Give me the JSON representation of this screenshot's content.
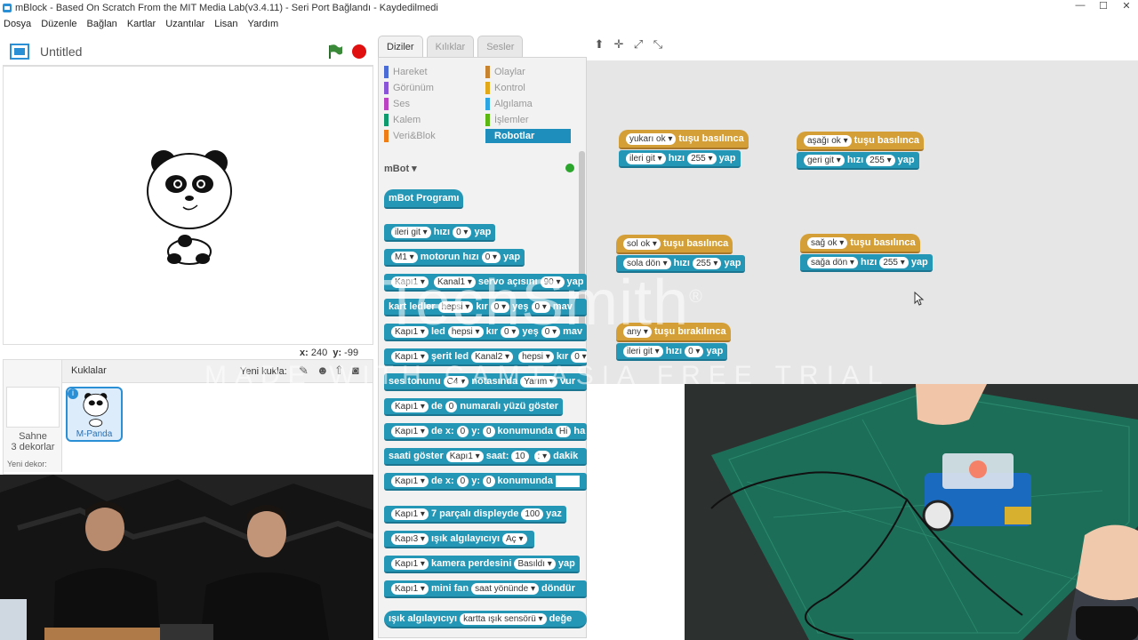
{
  "window": {
    "title": "mBlock - Based On Scratch From the MIT Media Lab(v3.4.11) - Seri Port Bağlandı - Kaydedilmedi"
  },
  "menu": [
    "Dosya",
    "Düzenle",
    "Bağlan",
    "Kartlar",
    "Uzantılar",
    "Lisan",
    "Yardım"
  ],
  "stage": {
    "title": "Untitled",
    "x_label": "x:",
    "x_value": "240",
    "y_label": "y:",
    "y_value": "-99"
  },
  "sprites": {
    "header": "Kuklalar",
    "new_sprite": "Yeni kukla:",
    "stage_label": "Sahne",
    "backdrops": "3 dekorlar",
    "new_backdrop": "Yeni dekor:",
    "sprite_name": "M-Panda"
  },
  "tabs": [
    "Diziler",
    "Kılıklar",
    "Sesler"
  ],
  "categories": [
    {
      "name": "Hareket",
      "color": "#4a6cd4"
    },
    {
      "name": "Görünüm",
      "color": "#8a55d7"
    },
    {
      "name": "Ses",
      "color": "#bb42c3"
    },
    {
      "name": "Kalem",
      "color": "#0e9a6c"
    },
    {
      "name": "Veri&Blok",
      "color": "#ee7d16"
    },
    {
      "name": "Olaylar",
      "color": "#c88330"
    },
    {
      "name": "Kontrol",
      "color": "#e1a91a"
    },
    {
      "name": "Algılama",
      "color": "#2ca5e2"
    },
    {
      "name": "İşlemler",
      "color": "#5cb712"
    },
    {
      "name": "Robotlar",
      "color": "#1e8ebc"
    }
  ],
  "palette": {
    "extension": "mBot",
    "hat": "mBot Programı",
    "b1": {
      "s": "ileri git",
      "t1": "hızı",
      "v": "0",
      "t2": "yap"
    },
    "b2": {
      "s": "M1",
      "t1": "motorun hızı",
      "v": "0",
      "t2": "yap"
    },
    "b3": {
      "s": "Kapı1",
      "s2": "Kanal1",
      "t1": "servo açısını",
      "v": "90",
      "t2": "yap"
    },
    "b4": {
      "t0": "kart ledler",
      "s": "hepsi",
      "t1": "kır",
      "v1": "0",
      "t2": "yeş",
      "v2": "0",
      "t3": "mav"
    },
    "b5": {
      "s": "Kapı1",
      "t0": "led",
      "s2": "hepsi",
      "t1": "kır",
      "v1": "0",
      "t2": "yeş",
      "v2": "0",
      "t3": "mav"
    },
    "b6": {
      "s": "Kapı1",
      "t0": "şerit led",
      "s2": "Kanal2",
      "s3": "hepsi",
      "t1": "kır",
      "v1": "0"
    },
    "b7": {
      "t0": "ses tonunu",
      "s": "C4",
      "t1": "notasında",
      "s2": "Yarım",
      "t2": "vur"
    },
    "b8": {
      "s": "Kapı1",
      "t0": "de",
      "v": "0",
      "t1": "numaralı yüzü göster"
    },
    "b9": {
      "s": "Kapı1",
      "t0": "de x:",
      "v1": "0",
      "t1": "y:",
      "v2": "0",
      "t2": "konumunda",
      "v3": "Hi",
      "t3": "ha"
    },
    "b10": {
      "t0": "saati göster",
      "s": "Kapı1",
      "t1": "saat:",
      "v1": "10",
      "s2": ":",
      "t2": "dakik"
    },
    "b11": {
      "s": "Kapı1",
      "t0": "de x:",
      "v1": "0",
      "t1": "y:",
      "v2": "0",
      "t2": "konumunda",
      "v3": ""
    },
    "b12": {
      "s": "Kapı1",
      "t0": "7 parçalı displeyde",
      "v": "100",
      "t1": "yaz"
    },
    "b13": {
      "s": "Kapı3",
      "t0": "ışık algılayıcıyı",
      "s2": "Aç"
    },
    "b14": {
      "s": "Kapı1",
      "t0": "kamera perdesini",
      "s2": "Basıldı",
      "t1": "yap"
    },
    "b15": {
      "s": "Kapı1",
      "t0": "mini fan",
      "s2": "saat yönünde",
      "t1": "döndür"
    },
    "b16": {
      "t0": "ışık algılayıcıyı",
      "s": "kartta ışık sensörü",
      "t1": "değe"
    }
  },
  "scripts": [
    {
      "key": "yukari",
      "hat_key": "yukarı ok",
      "hat_text": "tuşu basılınca",
      "cmd": "ileri git",
      "speed_label": "hızı",
      "speed": "255",
      "yap": "yap"
    },
    {
      "key": "asagi",
      "hat_key": "aşağı ok",
      "hat_text": "tuşu basılınca",
      "cmd": "geri git",
      "speed_label": "hızı",
      "speed": "255",
      "yap": "yap"
    },
    {
      "key": "sol",
      "hat_key": "sol ok",
      "hat_text": "tuşu basılınca",
      "cmd": "sola dön",
      "speed_label": "hızı",
      "speed": "255",
      "yap": "yap"
    },
    {
      "key": "sag",
      "hat_key": "sağ ok",
      "hat_text": "tuşu basılınca",
      "cmd": "sağa dön",
      "speed_label": "hızı",
      "speed": "255",
      "yap": "yap"
    },
    {
      "key": "any",
      "hat_key": "any",
      "hat_text": "tuşu bırakılınca",
      "cmd": "ileri git",
      "speed_label": "hızı",
      "speed": "0",
      "yap": "yap"
    }
  ],
  "watermark": {
    "brand": "TechSmith",
    "trademark": "®",
    "trial": "MADE WITH CAMTASIA FREE TRIAL"
  }
}
